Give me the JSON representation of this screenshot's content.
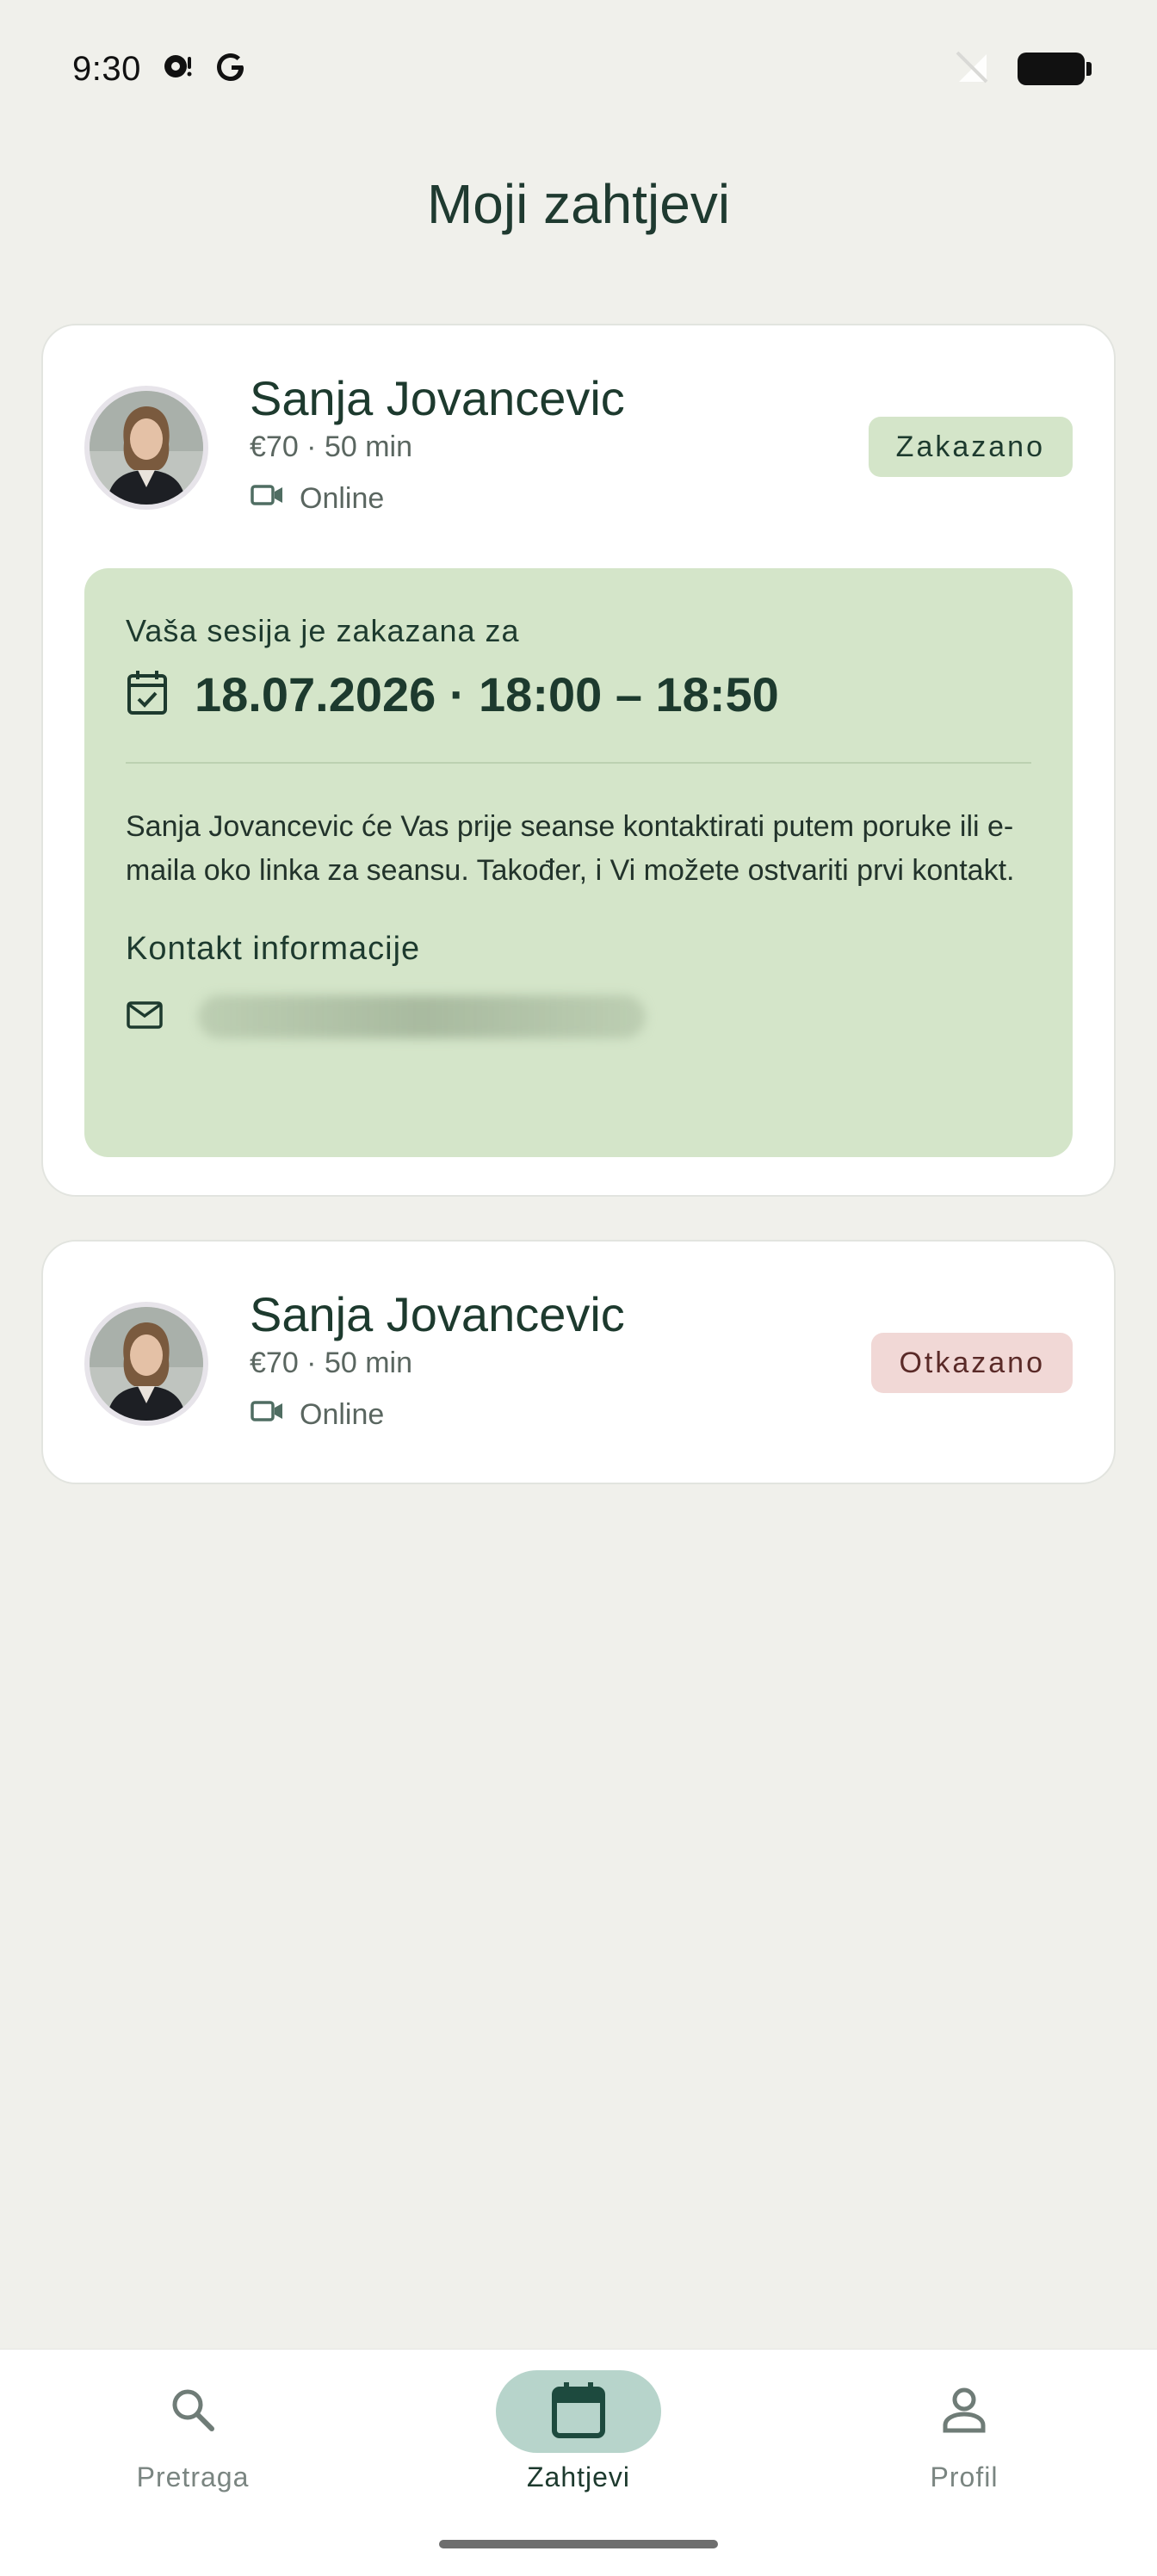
{
  "status_bar": {
    "time": "9:30"
  },
  "header": {
    "title": "Moji zahtjevi"
  },
  "requests": [
    {
      "provider_name": "Sanja Jovancevic",
      "price_duration": "€70 · 50 min",
      "mode": "Online",
      "status": "Zakazano",
      "status_color": "#d4e5c9",
      "session": {
        "caption": "Vaša sesija je zakazana za",
        "datetime": "18.07.2026 · 18:00 – 18:50",
        "note": "Sanja Jovancevic će Vas prije seanse kontaktirati putem poruke ili e-maila oko linka za seansu. Također, i Vi možete ostvariti prvi kontakt.",
        "contact_heading": "Kontakt informacije"
      }
    },
    {
      "provider_name": "Sanja Jovancevic",
      "price_duration": "€70 · 50 min",
      "mode": "Online",
      "status": "Otkazano",
      "status_color": "#f1d8d6"
    }
  ],
  "bottom_nav": {
    "items": [
      {
        "label": "Pretraga",
        "icon": "search-icon",
        "active": false
      },
      {
        "label": "Zahtjevi",
        "icon": "calendar-icon",
        "active": true
      },
      {
        "label": "Profil",
        "icon": "person-icon",
        "active": false
      }
    ]
  },
  "colors": {
    "background": "#f0f0eb",
    "primary_text": "#1d3a2e",
    "session_box": "#d4e5c9",
    "active_nav_pill": "#b7d4cb"
  }
}
